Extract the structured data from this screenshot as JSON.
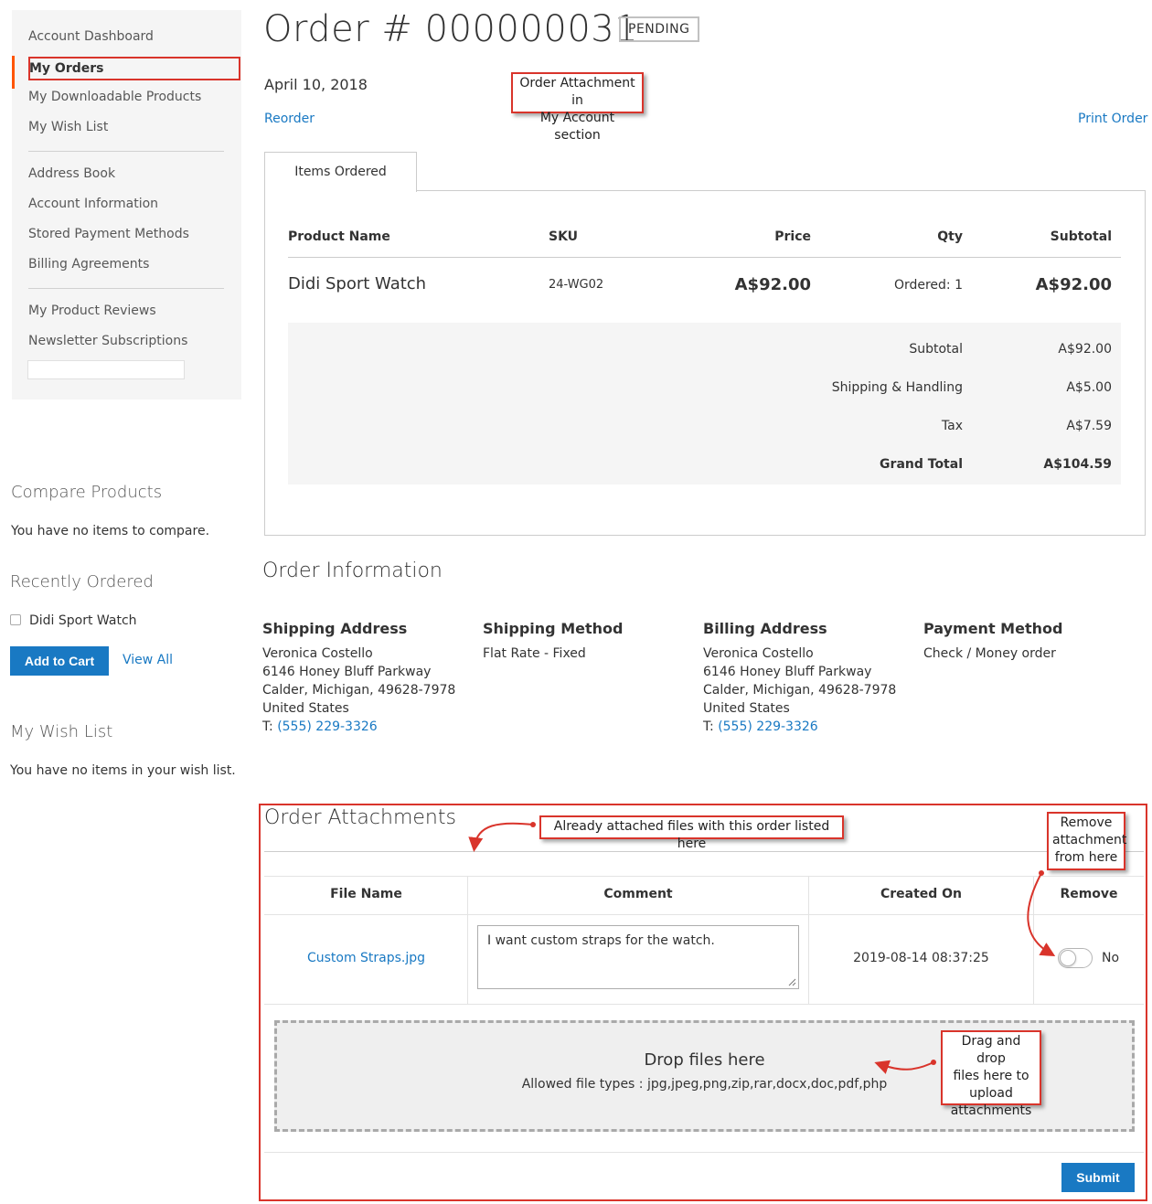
{
  "sidebar": {
    "nav": {
      "account_dashboard": "Account Dashboard",
      "my_orders": "My Orders",
      "my_downloadable_products": "My Downloadable Products",
      "my_wish_list": "My Wish List",
      "address_book": "Address Book",
      "account_information": "Account Information",
      "stored_payment_methods": "Stored Payment Methods",
      "billing_agreements": "Billing Agreements",
      "my_product_reviews": "My Product Reviews",
      "newsletter_subscriptions": "Newsletter Subscriptions"
    },
    "compare": {
      "title": "Compare Products",
      "empty": "You have no items to compare."
    },
    "recently_ordered": {
      "title": "Recently Ordered",
      "item": "Didi Sport Watch",
      "add_to_cart": "Add to Cart",
      "view_all": "View All"
    },
    "wish_list": {
      "title": "My Wish List",
      "empty": "You have no items in your wish list."
    }
  },
  "order": {
    "title": "Order # 000000031",
    "status": "PENDING",
    "date": "April 10, 2018",
    "reorder": "Reorder",
    "print_order": "Print Order"
  },
  "callouts": {
    "account_section_line1": "Order Attachment in",
    "account_section_line2": "My Account section",
    "already_attached": "Already attached files with this order listed here",
    "remove_line1": "Remove",
    "remove_line2": "attachment",
    "remove_line3": "from here",
    "drag_line1": "Drag and drop",
    "drag_line2": "files here to",
    "drag_line3": "upload",
    "drag_line4": "attachments"
  },
  "items_ordered": {
    "tab_label": "Items Ordered",
    "headers": {
      "product_name": "Product Name",
      "sku": "SKU",
      "price": "Price",
      "qty": "Qty",
      "subtotal": "Subtotal"
    },
    "row": {
      "product_name": "Didi Sport Watch",
      "sku": "24-WG02",
      "price": "A$92.00",
      "qty": "Ordered: 1",
      "subtotal": "A$92.00"
    },
    "totals": {
      "subtotal_label": "Subtotal",
      "subtotal_value": "A$92.00",
      "shipping_label": "Shipping & Handling",
      "shipping_value": "A$5.00",
      "tax_label": "Tax",
      "tax_value": "A$7.59",
      "grand_total_label": "Grand Total",
      "grand_total_value": "A$104.59"
    }
  },
  "order_information": {
    "title": "Order Information",
    "shipping_address": {
      "title": "Shipping Address",
      "name": "Veronica Costello",
      "street": "6146 Honey Bluff Parkway",
      "city": "Calder, Michigan, 49628-7978",
      "country": "United States",
      "phone_prefix": "T:",
      "phone": "(555) 229-3326"
    },
    "shipping_method": {
      "title": "Shipping Method",
      "value": "Flat Rate - Fixed"
    },
    "billing_address": {
      "title": "Billing Address",
      "name": "Veronica Costello",
      "street": "6146 Honey Bluff Parkway",
      "city": "Calder, Michigan, 49628-7978",
      "country": "United States",
      "phone_prefix": "T:",
      "phone": "(555) 229-3326"
    },
    "payment_method": {
      "title": "Payment Method",
      "value": "Check / Money order"
    }
  },
  "attachments": {
    "title": "Order Attachments",
    "headers": {
      "file_name": "File Name",
      "comment": "Comment",
      "created_on": "Created On",
      "remove": "Remove"
    },
    "row": {
      "file_name": "Custom Straps.jpg",
      "comment": "I want custom straps for the watch.",
      "created_on": "2019-08-14 08:37:25",
      "remove_state": "No"
    },
    "dropzone": {
      "title": "Drop files here",
      "allowed": "Allowed file types : jpg,jpeg,png,zip,rar,docx,doc,pdf,php"
    },
    "submit": "Submit"
  },
  "colors": {
    "accent_blue": "#1979c3",
    "highlight_red": "#d9342b",
    "active_nav_orange": "#ff5501",
    "panel_gray": "#f5f5f5"
  },
  "icons": {
    "checkbox": "checkbox-icon",
    "arrow": "curved-arrow-icon",
    "resize": "resize-handle-icon"
  }
}
